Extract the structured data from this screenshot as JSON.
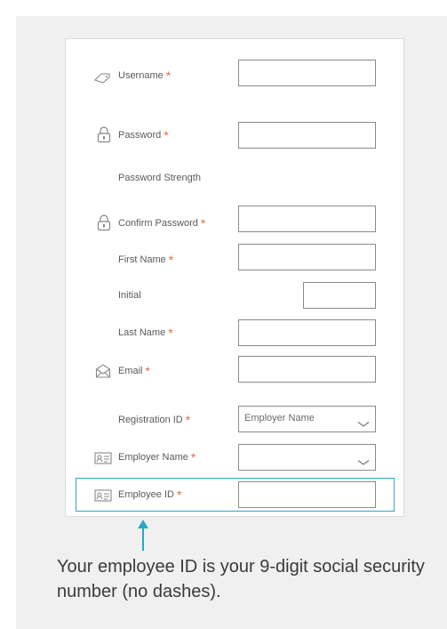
{
  "form": {
    "username_label": "Username",
    "password_label": "Password",
    "password_strength_label": "Password Strength",
    "confirm_password_label": "Confirm Password",
    "first_name_label": "First Name",
    "initial_label": "Initial",
    "last_name_label": "Last Name",
    "email_label": "Email",
    "registration_id_label": "Registration ID",
    "registration_id_value": "Employer Name",
    "employer_name_label": "Employer Name",
    "employer_name_value": "",
    "employee_id_label": "Employee ID",
    "required_marker": "*"
  },
  "callout": {
    "text": "Your employee ID is your 9-digit social security number (no dashes)."
  },
  "colors": {
    "required": "#e56a44",
    "highlight": "#2aa6c8",
    "panel_bg": "#f0f0f1"
  },
  "icons": {
    "username": "tag-icon",
    "password": "lock-icon",
    "confirm_password": "lock-icon",
    "email": "envelope-icon",
    "employer_name": "id-card-icon",
    "employee_id": "id-card-icon"
  }
}
